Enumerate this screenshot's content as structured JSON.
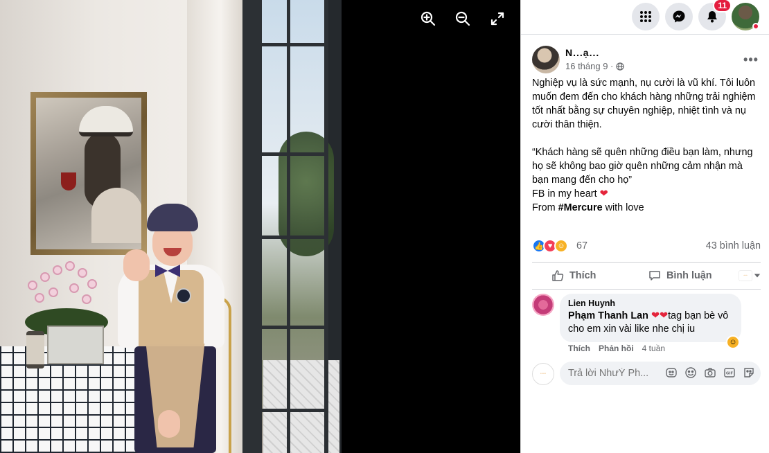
{
  "viewer": {
    "zoom_in": "zoom-in-icon",
    "zoom_out": "zoom-out-icon",
    "fullscreen": "fullscreen-icon"
  },
  "topbar": {
    "menu_icon": "grid-menu-icon",
    "messenger_icon": "messenger-icon",
    "notifications_icon": "bell-icon",
    "notifications_count": "11"
  },
  "post": {
    "author": "N...ạ...",
    "date": "16 tháng 9 ·",
    "text_lines": [
      "Nghiệp vụ là sức mạnh, nụ cười là vũ khí. Tôi luôn muốn đem đến cho khách hàng những trải nghiệm tốt nhất bằng sự chuyên nghiệp, nhiệt tình và nụ cười thân thiện.",
      "“Khách hàng sẽ quên những điều bạn làm, nhưng họ sẽ không bao giờ quên những cảm nhận mà bạn mang đến cho họ”",
      "FB in my heart",
      "From",
      "#Mercure",
      "with love"
    ],
    "reaction_count": "67",
    "comment_count": "43 bình luận",
    "like_label": "Thích",
    "comment_label": "Bình luận"
  },
  "comment": {
    "author": "Lien Huynh",
    "tag": "Phạm Thanh Lan",
    "text": "tag bạn bè vô cho em xin vài like nhe chị iu",
    "like": "Thích",
    "reply": "Phản hồi",
    "time": "4 tuần"
  },
  "reply_box": {
    "placeholder": "Trả lời NhưÝ Ph..."
  },
  "colors": {
    "accent": "#1877f2",
    "notification": "#e41e3f",
    "heart": "#e4243b"
  }
}
